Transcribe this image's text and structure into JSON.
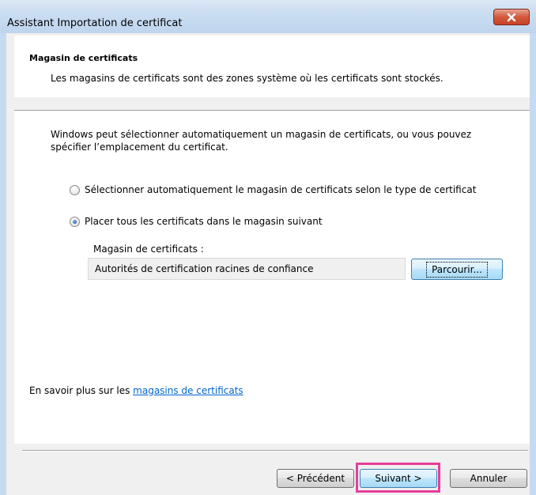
{
  "window": {
    "title": "Assistant Importation de certificat",
    "close_symbol": "✕"
  },
  "header": {
    "title": "Magasin de certificats",
    "description": "Les magasins de certificats sont des zones système où les certificats sont stockés."
  },
  "body": {
    "instructions": "Windows peut sélectionner automatiquement un magasin de certificats, ou vous pouvez spécifier l’emplacement du certificat.",
    "options": [
      {
        "label": "Sélectionner automatiquement le magasin de certificats selon le type de certificat",
        "selected": false
      },
      {
        "label": "Placer tous les certificats dans le magasin suivant",
        "selected": true
      }
    ],
    "store_label": "Magasin de certificats :",
    "store_value": "Autorités de certification racines de confiance",
    "browse_label": "Parcourir..."
  },
  "learn_more": {
    "prefix": "En savoir plus sur les ",
    "link_text": "magasins de certificats"
  },
  "footer": {
    "prev_label": "< Précédent",
    "next_label": "Suivant >",
    "cancel_label": "Annuler"
  },
  "colors": {
    "highlight": "#e83e9a",
    "link": "#0066cc",
    "close_button": "#c6432a"
  }
}
